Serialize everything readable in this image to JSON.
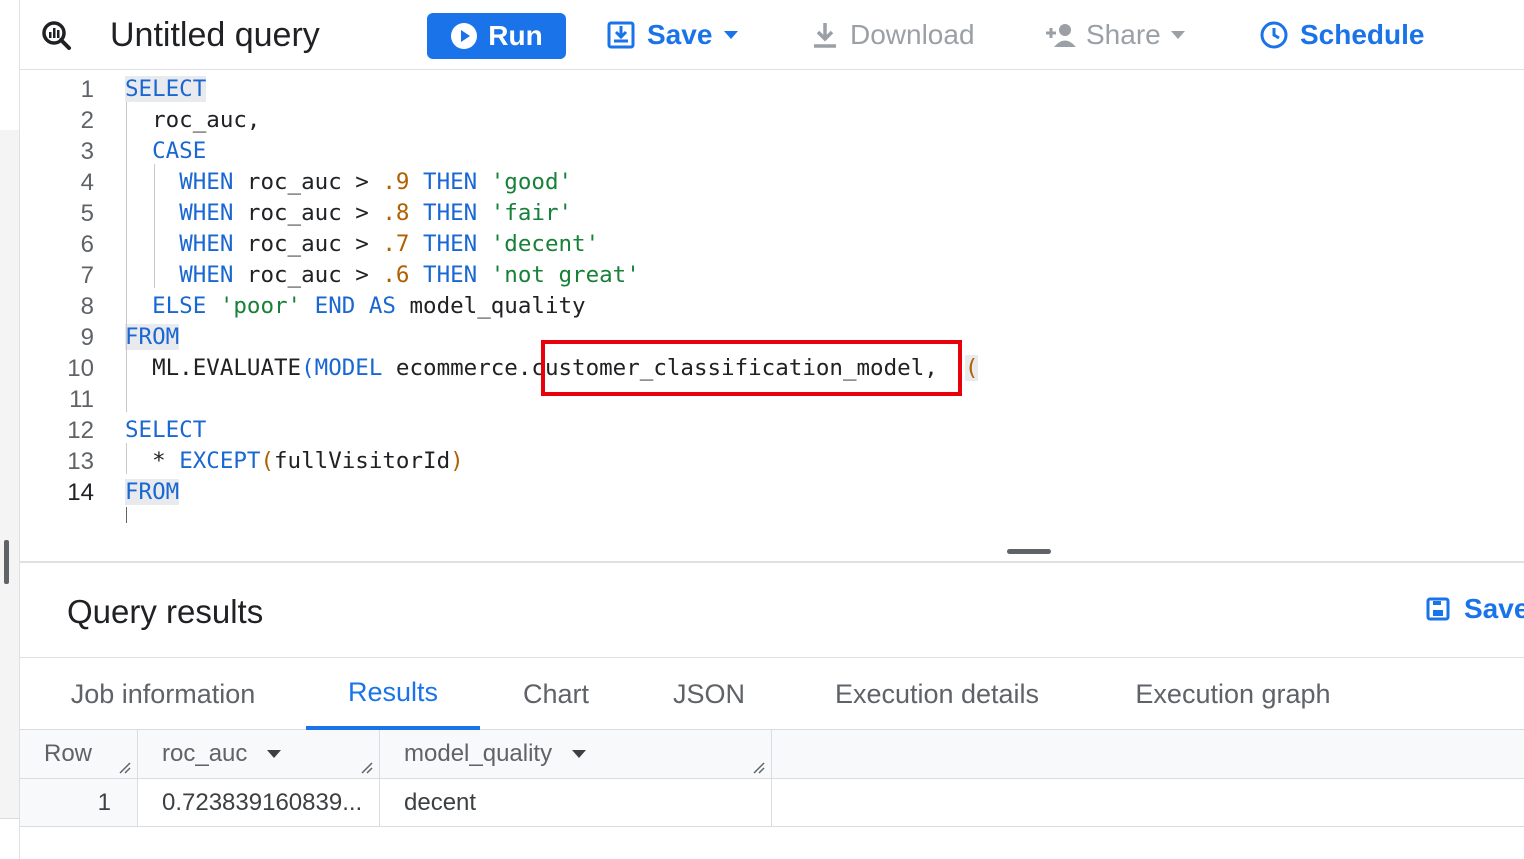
{
  "toolbar": {
    "title": "Untitled query",
    "run_label": "Run",
    "save_label": "Save",
    "download_label": "Download",
    "share_label": "Share",
    "schedule_label": "Schedule"
  },
  "editor": {
    "lines": [
      {
        "n": "1",
        "tokens": [
          {
            "t": "SELECT",
            "c": "kw hl"
          }
        ]
      },
      {
        "n": "2",
        "tokens": [
          {
            "t": "  roc_auc,",
            "c": ""
          }
        ]
      },
      {
        "n": "3",
        "tokens": [
          {
            "t": "  ",
            "c": ""
          },
          {
            "t": "CASE",
            "c": "kw"
          }
        ]
      },
      {
        "n": "4",
        "tokens": [
          {
            "t": "    ",
            "c": ""
          },
          {
            "t": "WHEN",
            "c": "kw"
          },
          {
            "t": " roc_auc > ",
            "c": ""
          },
          {
            "t": ".9",
            "c": "num"
          },
          {
            "t": " ",
            "c": ""
          },
          {
            "t": "THEN",
            "c": "kw"
          },
          {
            "t": " ",
            "c": ""
          },
          {
            "t": "'good'",
            "c": "str"
          }
        ]
      },
      {
        "n": "5",
        "tokens": [
          {
            "t": "    ",
            "c": ""
          },
          {
            "t": "WHEN",
            "c": "kw"
          },
          {
            "t": " roc_auc > ",
            "c": ""
          },
          {
            "t": ".8",
            "c": "num"
          },
          {
            "t": " ",
            "c": ""
          },
          {
            "t": "THEN",
            "c": "kw"
          },
          {
            "t": " ",
            "c": ""
          },
          {
            "t": "'fair'",
            "c": "str"
          }
        ]
      },
      {
        "n": "6",
        "tokens": [
          {
            "t": "    ",
            "c": ""
          },
          {
            "t": "WHEN",
            "c": "kw"
          },
          {
            "t": " roc_auc > ",
            "c": ""
          },
          {
            "t": ".7",
            "c": "num"
          },
          {
            "t": " ",
            "c": ""
          },
          {
            "t": "THEN",
            "c": "kw"
          },
          {
            "t": " ",
            "c": ""
          },
          {
            "t": "'decent'",
            "c": "str"
          }
        ]
      },
      {
        "n": "7",
        "tokens": [
          {
            "t": "    ",
            "c": ""
          },
          {
            "t": "WHEN",
            "c": "kw"
          },
          {
            "t": " roc_auc > ",
            "c": ""
          },
          {
            "t": ".6",
            "c": "num"
          },
          {
            "t": " ",
            "c": ""
          },
          {
            "t": "THEN",
            "c": "kw"
          },
          {
            "t": " ",
            "c": ""
          },
          {
            "t": "'not great'",
            "c": "str"
          }
        ]
      },
      {
        "n": "8",
        "tokens": [
          {
            "t": "  ",
            "c": ""
          },
          {
            "t": "ELSE",
            "c": "kw"
          },
          {
            "t": " ",
            "c": ""
          },
          {
            "t": "'poor'",
            "c": "str"
          },
          {
            "t": " ",
            "c": ""
          },
          {
            "t": "END",
            "c": "kw"
          },
          {
            "t": " ",
            "c": ""
          },
          {
            "t": "AS",
            "c": "kw"
          },
          {
            "t": " model_quality",
            "c": ""
          }
        ]
      },
      {
        "n": "9",
        "tokens": [
          {
            "t": "FROM",
            "c": "kw hl"
          }
        ]
      },
      {
        "n": "10",
        "tokens": [
          {
            "t": "  ML.EVALUATE",
            "c": ""
          },
          {
            "t": "(",
            "c": "kw"
          },
          {
            "t": "MODEL",
            "c": "kw"
          },
          {
            "t": " ecommerce.customer_classification_model,  ",
            "c": ""
          },
          {
            "t": "(",
            "c": "num hl"
          }
        ]
      },
      {
        "n": "11",
        "tokens": []
      },
      {
        "n": "12",
        "tokens": [
          {
            "t": "SELECT",
            "c": "kw"
          }
        ]
      },
      {
        "n": "13",
        "tokens": [
          {
            "t": "  * ",
            "c": ""
          },
          {
            "t": "EXCEPT",
            "c": "kw"
          },
          {
            "t": "(",
            "c": "num"
          },
          {
            "t": "fullVisitorId",
            "c": ""
          },
          {
            "t": ")",
            "c": "num"
          }
        ]
      },
      {
        "n": "14",
        "tokens": [
          {
            "t": "FROM",
            "c": "kw hl"
          }
        ]
      }
    ],
    "active_line": "14"
  },
  "results": {
    "title": "Query results",
    "save_label": "Save",
    "tabs": [
      "Job information",
      "Results",
      "Chart",
      "JSON",
      "Execution details",
      "Execution graph"
    ],
    "active_tab": "Results",
    "columns": [
      "Row",
      "roc_auc",
      "model_quality"
    ],
    "rows": [
      [
        "1",
        "0.723839160839...",
        "decent"
      ]
    ]
  },
  "colors": {
    "accent": "#1a73e8",
    "highlight_box": "#e8000b"
  },
  "icons": {
    "query": "query-magnifier-icon",
    "run": "play-circle-icon",
    "save": "save-download-icon",
    "download": "download-icon",
    "share": "person-add-icon",
    "schedule": "clock-icon"
  }
}
